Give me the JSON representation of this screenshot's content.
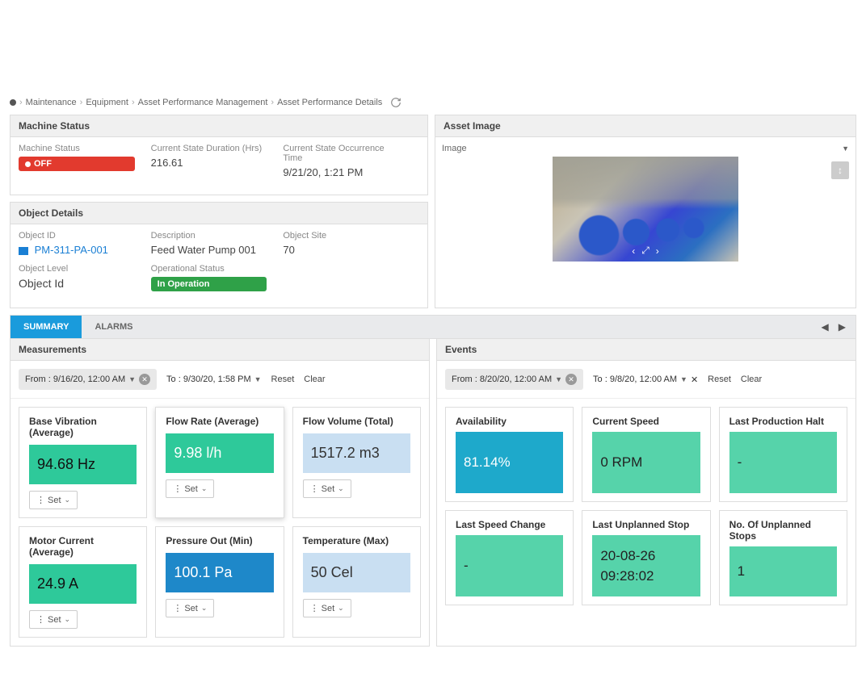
{
  "breadcrumb": [
    "Maintenance",
    "Equipment",
    "Asset Performance Management",
    "Asset Performance Details"
  ],
  "machineStatus": {
    "header": "Machine Status",
    "statusLabel": "Machine Status",
    "statusBadge": "OFF",
    "durationLabel": "Current State Duration (Hrs)",
    "durationValue": "216.61",
    "occLabel": "Current State Occurrence Time",
    "occValue": "9/21/20, 1:21 PM"
  },
  "objectDetails": {
    "header": "Object Details",
    "idLabel": "Object ID",
    "idValue": "PM-311-PA-001",
    "descLabel": "Description",
    "descValue": "Feed Water Pump 001",
    "siteLabel": "Object Site",
    "siteValue": "70",
    "levelLabel": "Object Level",
    "levelValue": "Object Id",
    "opLabel": "Operational Status",
    "opBadge": "In Operation"
  },
  "assetImage": {
    "header": "Asset Image",
    "imgLabel": "Image"
  },
  "tabs": {
    "summary": "SUMMARY",
    "alarms": "ALARMS"
  },
  "measurements": {
    "header": "Measurements",
    "from": "From : 9/16/20, 12:00 AM",
    "to": "To : 9/30/20, 1:58 PM",
    "reset": "Reset",
    "clear": "Clear",
    "setLabel": "Set",
    "cards": [
      {
        "title": "Base Vibration (Average)",
        "value": "94.68 Hz",
        "cls": "teal"
      },
      {
        "title": "Flow Rate (Average)",
        "value": "9.98 l/h",
        "cls": "tealw",
        "shadow": true
      },
      {
        "title": "Flow Volume (Total)",
        "value": "1517.2 m3",
        "cls": "lightblue"
      },
      {
        "title": "Motor Current (Average)",
        "value": "24.9 A",
        "cls": "teal"
      },
      {
        "title": "Pressure Out (Min)",
        "value": "100.1 Pa",
        "cls": "blue"
      },
      {
        "title": "Temperature (Max)",
        "value": "50 Cel",
        "cls": "lightblue"
      }
    ]
  },
  "events": {
    "header": "Events",
    "from": "From : 8/20/20, 12:00 AM",
    "to": "To : 9/8/20, 12:00 AM",
    "reset": "Reset",
    "clear": "Clear",
    "cards": [
      {
        "title": "Availability",
        "value": "81.14%",
        "cls": "cyan"
      },
      {
        "title": "Current Speed",
        "value": "0 RPM",
        "cls": ""
      },
      {
        "title": "Last Production Halt",
        "value": "-",
        "cls": ""
      },
      {
        "title": "Last Speed Change",
        "value": "-",
        "cls": ""
      },
      {
        "title": "Last Unplanned Stop",
        "value": "20-08-26\n09:28:02",
        "cls": ""
      },
      {
        "title": "No. Of Unplanned Stops",
        "value": "1",
        "cls": ""
      }
    ]
  }
}
